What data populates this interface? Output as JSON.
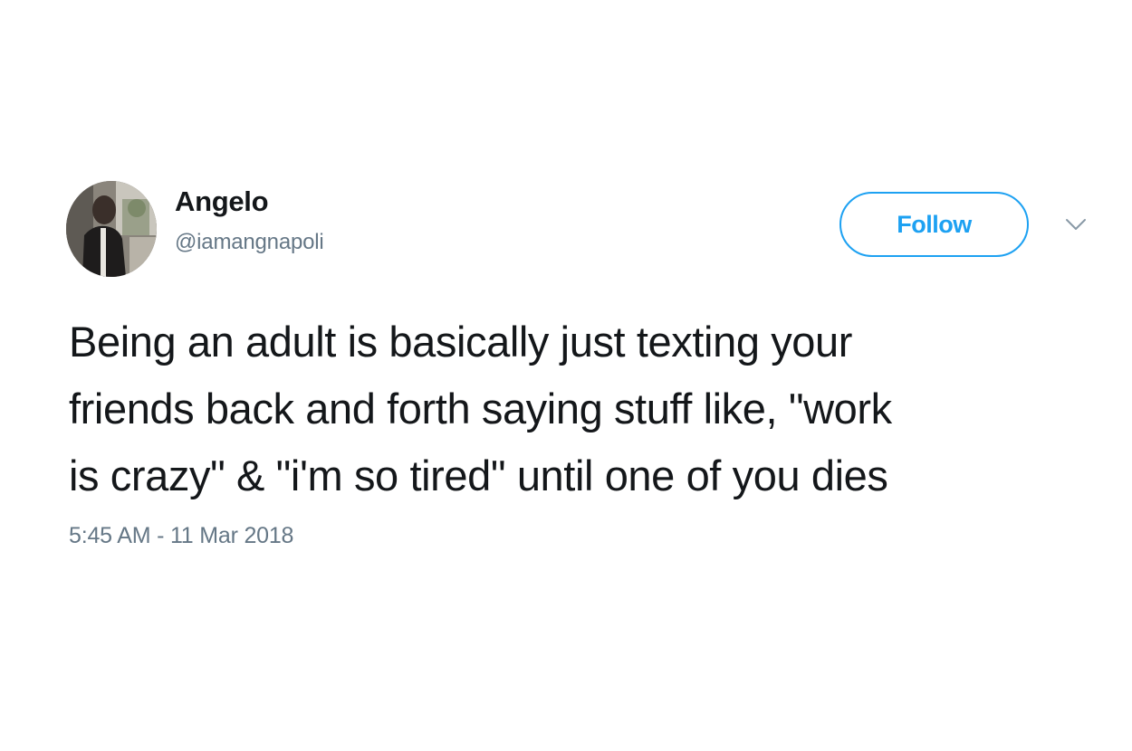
{
  "tweet": {
    "author": {
      "display_name": "Angelo",
      "handle": "@iamangnapoli",
      "avatar_icon": "profile-photo"
    },
    "follow_label": "Follow",
    "menu_icon": "chevron-down-icon",
    "text_lines": [
      "Being an adult is basically just texting your",
      "friends back and forth saying stuff like, \"work",
      "is crazy\" & \"i'm so tired\" until one of you dies"
    ],
    "timestamp": "5:45 AM - 11 Mar 2018"
  },
  "colors": {
    "accent": "#1da1f2",
    "text": "#14171a",
    "secondary_text": "#657786",
    "background": "#ffffff"
  }
}
